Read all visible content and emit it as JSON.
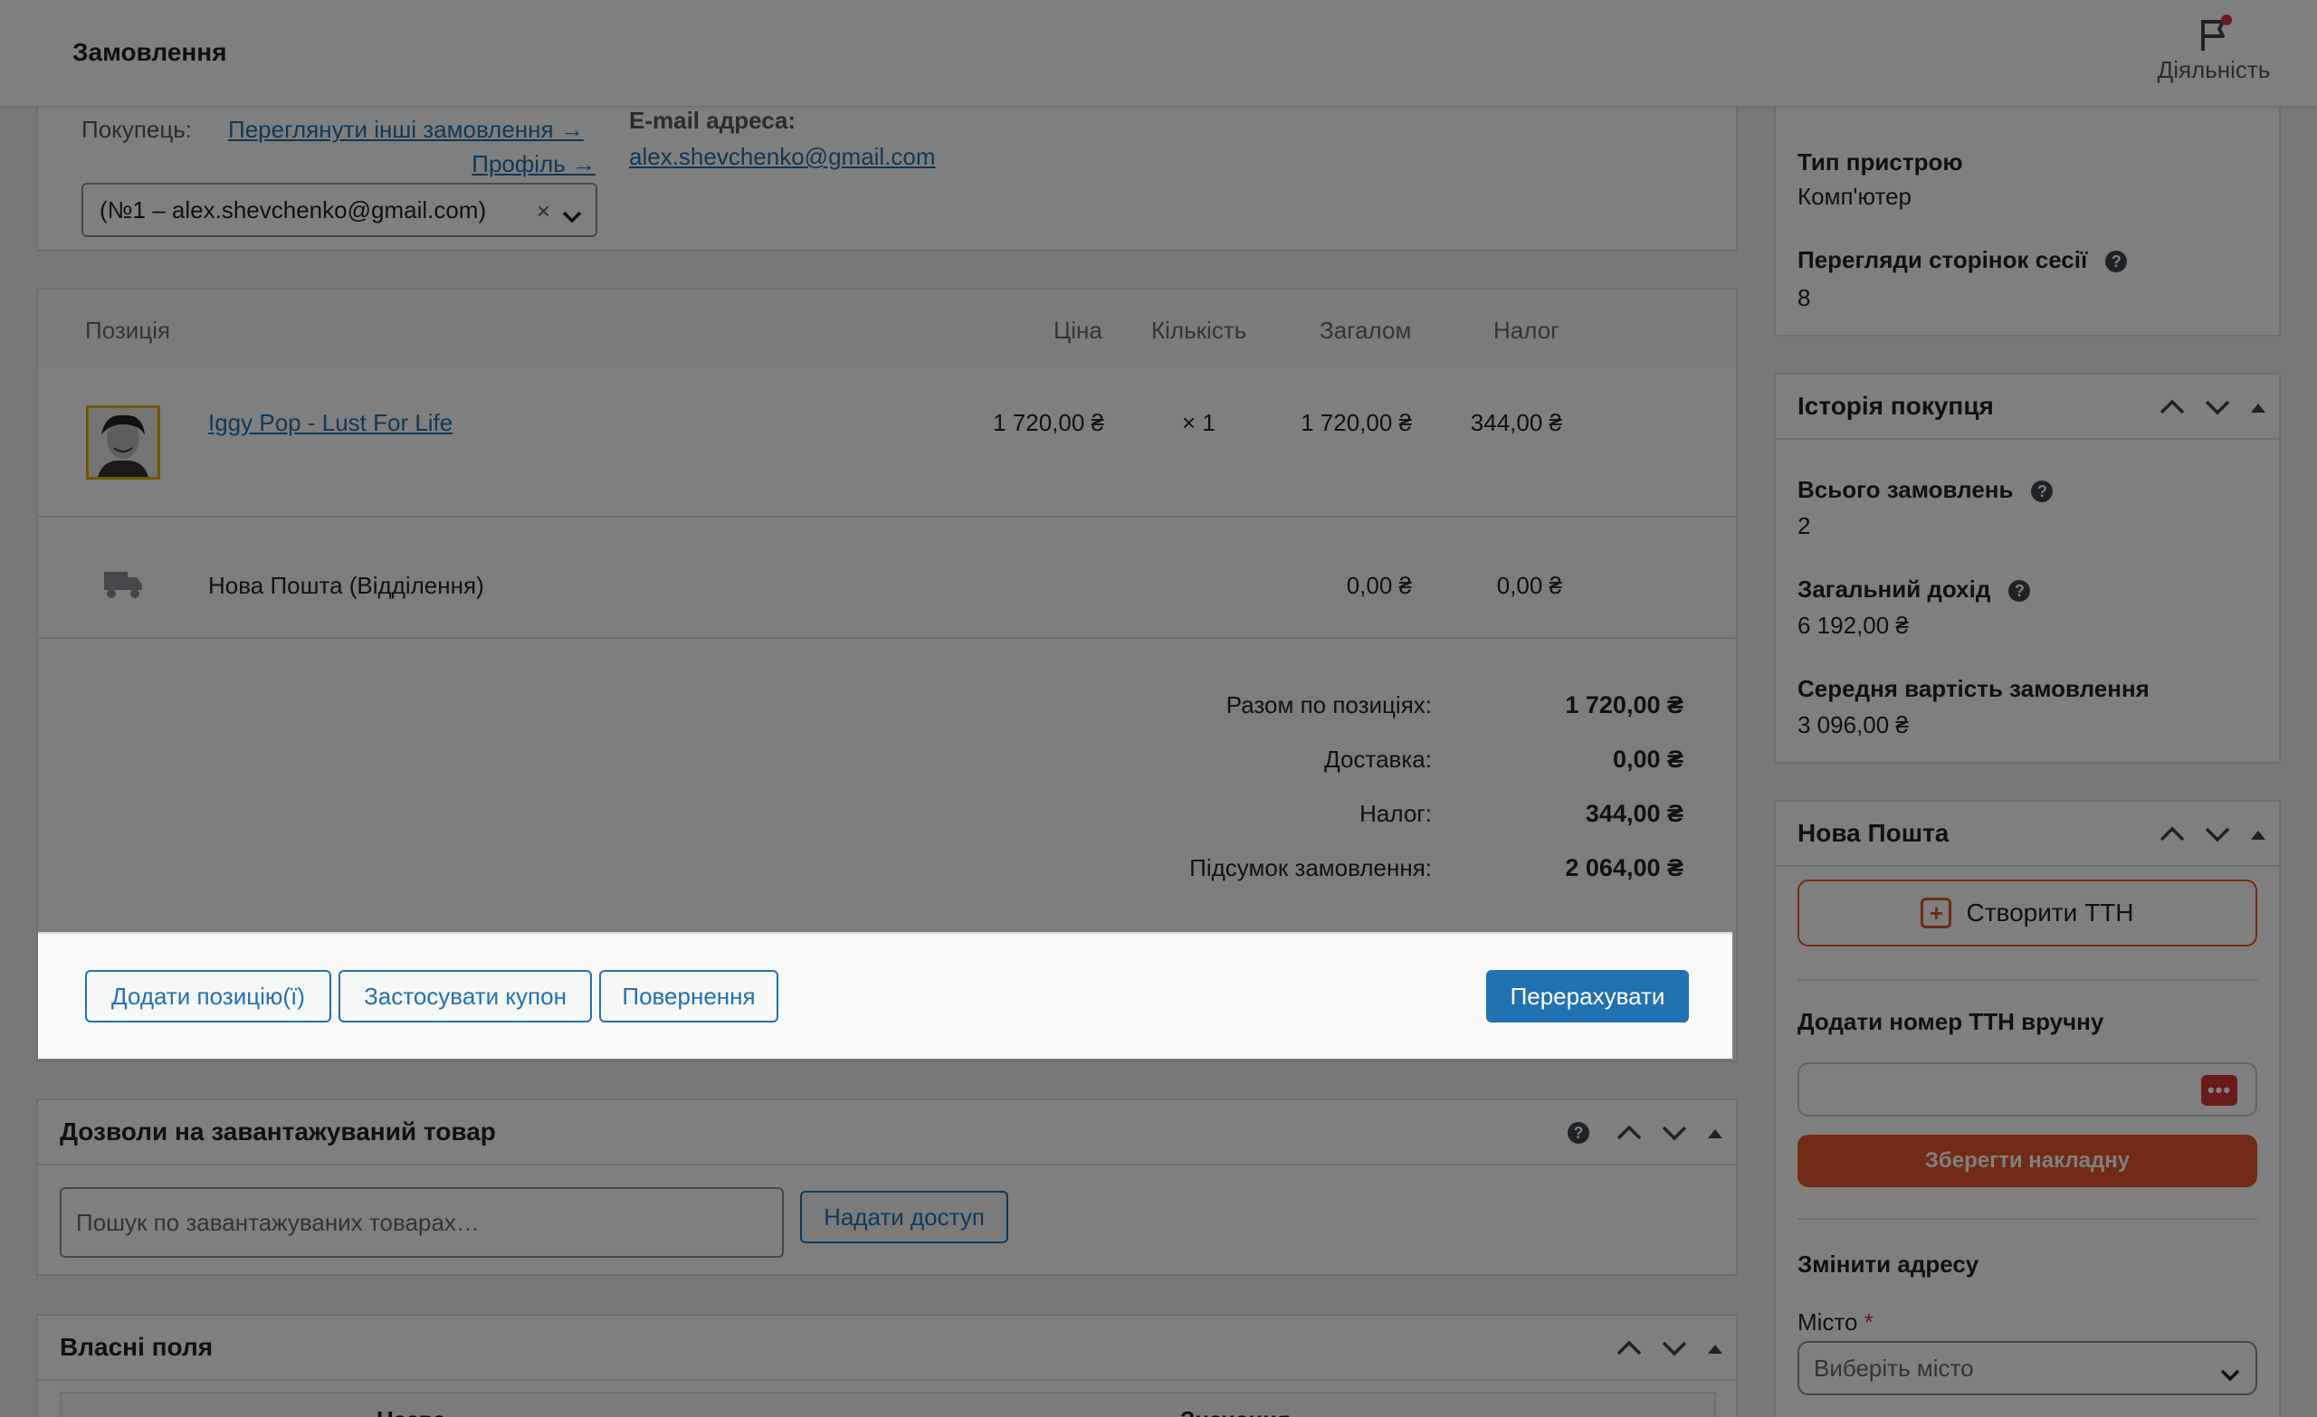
{
  "header": {
    "title": "Замовлення",
    "activity_label": "Діяльність"
  },
  "customer": {
    "label": "Покупець:",
    "other_orders_link": "Переглянути інші замовлення →",
    "profile_link": "Профіль →",
    "selected": "(№1 – alex.shevchenko@gmail.com)",
    "clear": "×",
    "email_label": "E-mail адреса:",
    "email": "alex.shevchenko@gmail.com"
  },
  "items": {
    "columns": {
      "item": "Позиція",
      "price": "Ціна",
      "qty": "Кількість",
      "total": "Загалом",
      "tax": "Налог"
    },
    "rows": [
      {
        "name": "Iggy Pop - Lust For Life",
        "price": "1 720,00 ₴",
        "qty": "× 1",
        "total": "1 720,00 ₴",
        "tax": "344,00 ₴"
      }
    ],
    "shipping": {
      "name": "Нова Пошта (Відділення)",
      "total": "0,00 ₴",
      "tax": "0,00 ₴"
    },
    "totals": [
      {
        "label": "Разом по позиціях:",
        "value": "1 720,00 ₴"
      },
      {
        "label": "Доставка:",
        "value": "0,00 ₴"
      },
      {
        "label": "Налог:",
        "value": "344,00 ₴"
      },
      {
        "label": "Підсумок замовлення:",
        "value": "2 064,00 ₴"
      }
    ],
    "actions": {
      "add_items": "Додати позицію(ї)",
      "apply_coupon": "Застосувати купон",
      "refund": "Повернення",
      "recalculate": "Перерахувати"
    }
  },
  "downloads": {
    "title": "Дозволи на завантажуваний товар",
    "search_placeholder": "Пошук по завантажуваних товарах…",
    "grant_button": "Надати доступ"
  },
  "custom_fields": {
    "title": "Власні поля",
    "col_name": "Назва",
    "col_value": "Значення"
  },
  "sidebar": {
    "device_label": "Тип пристрою",
    "device_value": "Комп'ютер",
    "pageviews_label": "Перегляди сторінок сесії",
    "pageviews_value": "8",
    "history_title": "Історія покупця",
    "total_orders_label": "Всього замовлень",
    "total_orders_value": "2",
    "revenue_label": "Загальний дохід",
    "revenue_value": "6 192,00 ₴",
    "avg_label": "Середня вартість замовлення",
    "avg_value": "3 096,00 ₴",
    "np_title": "Нова Пошта",
    "create_ttn": "Створити ТТН",
    "add_ttn_label": "Додати номер ТТН вручну",
    "save_invoice": "Зберегти накладну",
    "change_address": "Змінити адресу",
    "city_label": "Місто",
    "city_required": "*",
    "city_placeholder": "Виберіть місто"
  },
  "colors": {
    "accent": "#2271b1",
    "nova_poshta": "#e3542a",
    "danger": "#d63638"
  }
}
